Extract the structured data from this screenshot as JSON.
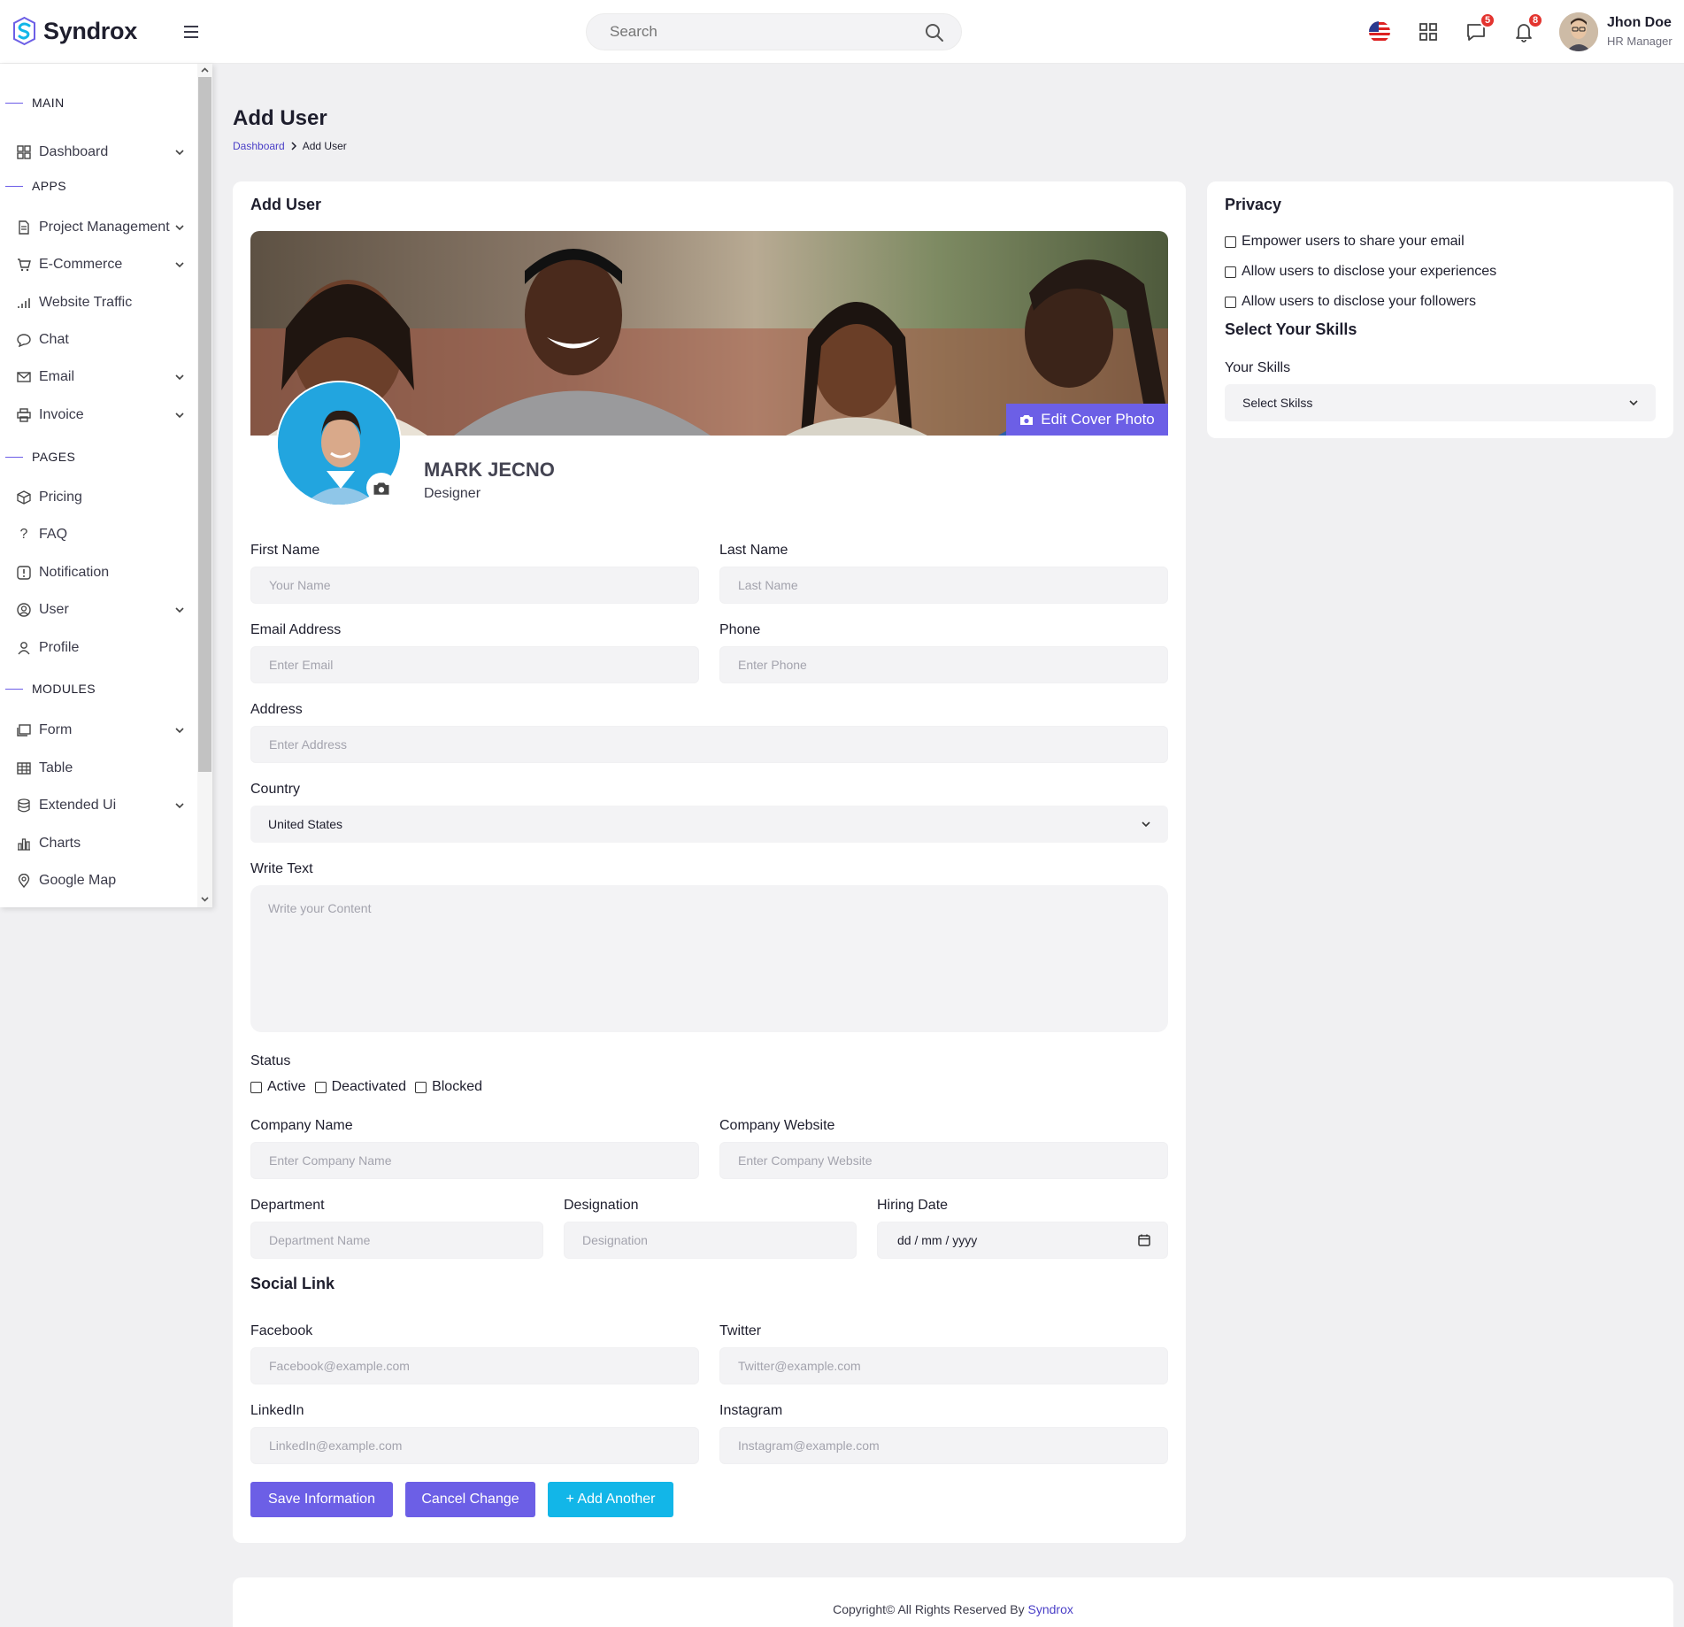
{
  "brand": {
    "name": "Syndrox"
  },
  "search": {
    "placeholder": "Search"
  },
  "header": {
    "messages_count": "5",
    "notifications_count": "8",
    "user_name": "Jhon Doe",
    "user_role": "HR Manager"
  },
  "sidebar": {
    "sections": {
      "main": "MAIN",
      "apps": "APPS",
      "pages": "PAGES",
      "modules": "MODULES"
    },
    "items": {
      "dashboard": "Dashboard",
      "project_management": "Project Management",
      "ecommerce": "E-Commerce",
      "website_traffic": "Website Traffic",
      "chat": "Chat",
      "email": "Email",
      "invoice": "Invoice",
      "pricing": "Pricing",
      "faq": "FAQ",
      "notification": "Notification",
      "user": "User",
      "profile": "Profile",
      "form": "Form",
      "table": "Table",
      "extended_ui": "Extended Ui",
      "charts": "Charts",
      "google_map": "Google Map"
    }
  },
  "page": {
    "title": "Add User",
    "breadcrumb_home": "Dashboard",
    "breadcrumb_current": "Add User"
  },
  "form": {
    "card_title": "Add User",
    "edit_cover_label": "Edit Cover Photo",
    "profile_name": "MARK JECNO",
    "profile_role": "Designer",
    "first_name": {
      "label": "First Name",
      "placeholder": "Your Name"
    },
    "last_name": {
      "label": "Last Name",
      "placeholder": "Last Name"
    },
    "email": {
      "label": "Email Address",
      "placeholder": "Enter Email"
    },
    "phone": {
      "label": "Phone",
      "placeholder": "Enter Phone"
    },
    "address": {
      "label": "Address",
      "placeholder": "Enter Address"
    },
    "country": {
      "label": "Country",
      "value": "United States"
    },
    "write_text": {
      "label": "Write Text",
      "placeholder": "Write your Content"
    },
    "status": {
      "label": "Status",
      "options": [
        "Active",
        "Deactivated",
        "Blocked"
      ]
    },
    "company_name": {
      "label": "Company Name",
      "placeholder": "Enter Company Name"
    },
    "company_website": {
      "label": "Company Website",
      "placeholder": "Enter Company Website"
    },
    "department": {
      "label": "Department",
      "placeholder": "Department Name"
    },
    "designation": {
      "label": "Designation",
      "placeholder": "Designation"
    },
    "hiring_date": {
      "label": "Hiring Date",
      "value": "dd / mm / yyyy"
    },
    "social_title": "Social Link",
    "facebook": {
      "label": "Facebook",
      "placeholder": "Facebook@example.com"
    },
    "twitter": {
      "label": "Twitter",
      "placeholder": "Twitter@example.com"
    },
    "linkedin": {
      "label": "LinkedIn",
      "placeholder": "LinkedIn@example.com"
    },
    "instagram": {
      "label": "Instagram",
      "placeholder": "Instagram@example.com"
    },
    "buttons": {
      "save": "Save Information",
      "cancel": "Cancel Change",
      "add_another": "+ Add Another"
    }
  },
  "privacy": {
    "title": "Privacy",
    "options": [
      "Empower users to share your email",
      "Allow users to disclose your experiences",
      "Allow users to disclose your followers"
    ],
    "skills_title": "Select Your Skills",
    "skills_label": "Your Skills",
    "skills_value": "Select Skilss"
  },
  "footer": {
    "text": "Copyright© All Rights Reserved By ",
    "link": "Syndrox"
  },
  "colors": {
    "primary": "#6c5fe6",
    "accent_cyan": "#12b6e8",
    "badge_red": "#e3342f",
    "link": "#4a3fc7"
  }
}
